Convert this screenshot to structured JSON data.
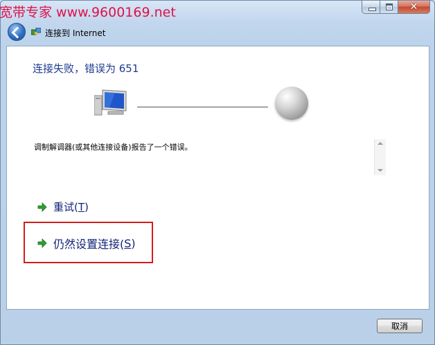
{
  "watermark": "宽带专家 www.9600169.net",
  "window": {
    "title": "连接到 Internet",
    "controls": {
      "close_symbol": "✕"
    }
  },
  "content": {
    "heading": "连接失败，错误为 651",
    "message": "调制解调器(或其他连接设备)报告了一个错误。",
    "options": [
      {
        "label": "重试(",
        "hotkey": "T",
        "suffix": ")"
      },
      {
        "label": "仍然设置连接(",
        "hotkey": "S",
        "suffix": ")"
      }
    ]
  },
  "footer": {
    "cancel_label": "取消"
  },
  "colors": {
    "heading": "#1e3a8f",
    "option_text": "#11227a",
    "highlight_box": "#d11c1c",
    "watermark": "#e0104a",
    "arrow_green": "#2ea02e"
  },
  "icons": [
    "back-arrow-icon",
    "network-icon",
    "computer-icon",
    "globe-icon",
    "green-arrow-icon"
  ]
}
